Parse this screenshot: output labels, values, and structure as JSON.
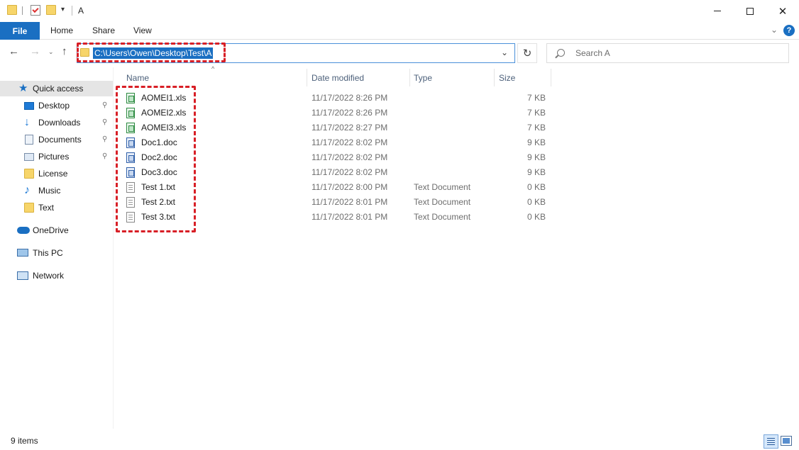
{
  "window": {
    "title": "A",
    "quick_access_dropdown": "▾",
    "minimize_glyph": "",
    "maximize_glyph": "",
    "close_glyph": "✕"
  },
  "ribbon": {
    "tabs": [
      "File",
      "Home",
      "Share",
      "View"
    ],
    "expand_glyph": "⌄",
    "help_glyph": "?"
  },
  "navigation": {
    "back_glyph": "←",
    "forward_glyph": "→",
    "recent_glyph": "⌄",
    "up_glyph": "↑",
    "address_path": "C:\\Users\\Owen\\Desktop\\Test\\A",
    "address_dropdown_glyph": "⌄",
    "refresh_glyph": "↻",
    "search_placeholder": "Search A"
  },
  "sidebar": {
    "items": [
      {
        "label": "Quick access",
        "icon": "star-icon",
        "pinned": false
      },
      {
        "label": "Desktop",
        "icon": "desktop-icon",
        "pinned": true
      },
      {
        "label": "Downloads",
        "icon": "download-icon",
        "pinned": true
      },
      {
        "label": "Documents",
        "icon": "documents-icon",
        "pinned": true
      },
      {
        "label": "Pictures",
        "icon": "pictures-icon",
        "pinned": true
      },
      {
        "label": "License",
        "icon": "folder-icon",
        "pinned": false
      },
      {
        "label": "Music",
        "icon": "music-icon",
        "pinned": false
      },
      {
        "label": "Text",
        "icon": "folder-icon",
        "pinned": false
      },
      {
        "label": "OneDrive",
        "icon": "cloud-icon",
        "pinned": false
      },
      {
        "label": "This PC",
        "icon": "computer-icon",
        "pinned": false
      },
      {
        "label": "Network",
        "icon": "network-icon",
        "pinned": false
      }
    ],
    "pin_glyph": "📌"
  },
  "columns": {
    "name": "Name",
    "date_modified": "Date modified",
    "type": "Type",
    "size": "Size",
    "sort_glyph": "^"
  },
  "files": [
    {
      "name": "AOMEI1.xls",
      "date": "11/17/2022 8:26 PM",
      "type": "",
      "size": "7 KB",
      "icon": "excel-file-icon"
    },
    {
      "name": "AOMEI2.xls",
      "date": "11/17/2022 8:26 PM",
      "type": "",
      "size": "7 KB",
      "icon": "excel-file-icon"
    },
    {
      "name": "AOMEI3.xls",
      "date": "11/17/2022 8:27 PM",
      "type": "",
      "size": "7 KB",
      "icon": "excel-file-icon"
    },
    {
      "name": "Doc1.doc",
      "date": "11/17/2022 8:02 PM",
      "type": "",
      "size": "9 KB",
      "icon": "word-file-icon"
    },
    {
      "name": "Doc2.doc",
      "date": "11/17/2022 8:02 PM",
      "type": "",
      "size": "9 KB",
      "icon": "word-file-icon"
    },
    {
      "name": "Doc3.doc",
      "date": "11/17/2022 8:02 PM",
      "type": "",
      "size": "9 KB",
      "icon": "word-file-icon"
    },
    {
      "name": "Test 1.txt",
      "date": "11/17/2022 8:00 PM",
      "type": "Text Document",
      "size": "0 KB",
      "icon": "text-file-icon"
    },
    {
      "name": "Test 2.txt",
      "date": "11/17/2022 8:01 PM",
      "type": "Text Document",
      "size": "0 KB",
      "icon": "text-file-icon"
    },
    {
      "name": "Test 3.txt",
      "date": "11/17/2022 8:01 PM",
      "type": "Text Document",
      "size": "0 KB",
      "icon": "text-file-icon"
    }
  ],
  "status": {
    "item_count": "9 items"
  },
  "colors": {
    "accent": "#1a6fc2",
    "highlight_border": "#d81f26"
  }
}
